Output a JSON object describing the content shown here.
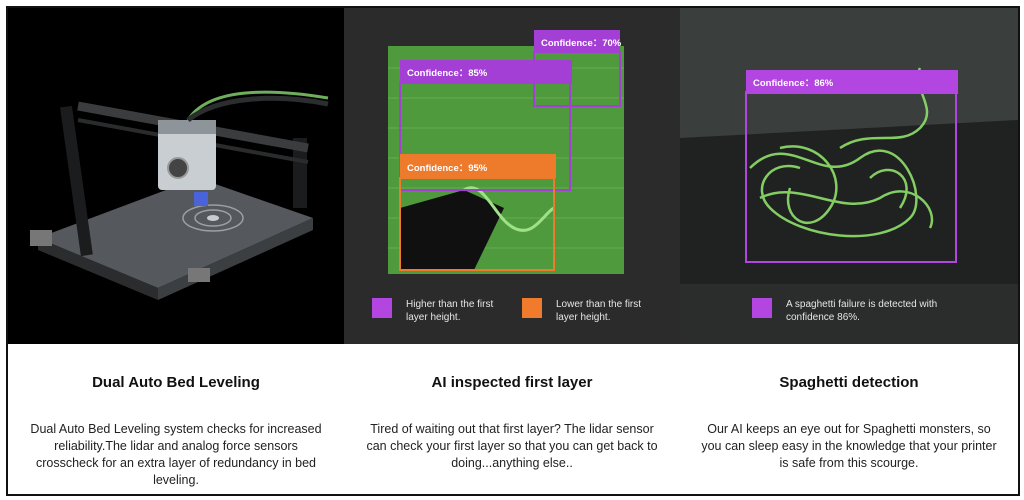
{
  "panels": {
    "bed_leveling": {
      "title": "Dual Auto Bed Leveling",
      "description": "Dual Auto Bed Leveling system checks for increased reliability.The lidar and analog force sensors crosscheck for an extra layer of redundancy in bed leveling."
    },
    "first_layer": {
      "title": "AI inspected first layer",
      "description": "Tired of waiting out that first layer? The lidar sensor can check your first layer so that you can get back to doing...anything else..",
      "boxes": [
        {
          "label": "Confidence：70%",
          "color": "#a43fd6"
        },
        {
          "label": "Confidence：85%",
          "color": "#a43fd6"
        },
        {
          "label": "Confidence：95%",
          "color": "#ee7a2c"
        }
      ],
      "legend": [
        {
          "text_line1": "Higher than the first",
          "text_line2": "layer height.",
          "color": "#b345e0"
        },
        {
          "text_line1": "Lower than the first",
          "text_line2": "layer height.",
          "color": "#f07b2d"
        }
      ]
    },
    "spaghetti": {
      "title": "Spaghetti detection",
      "description": "Our AI keeps an eye out for Spaghetti monsters, so you can sleep easy in the knowledge that your printer is safe from this scourge.",
      "box_label": "Confidence：86%",
      "legend_line1": "A spaghetti failure is detected with",
      "legend_line2": "confidence 86%.",
      "color": "#b345e0"
    }
  }
}
